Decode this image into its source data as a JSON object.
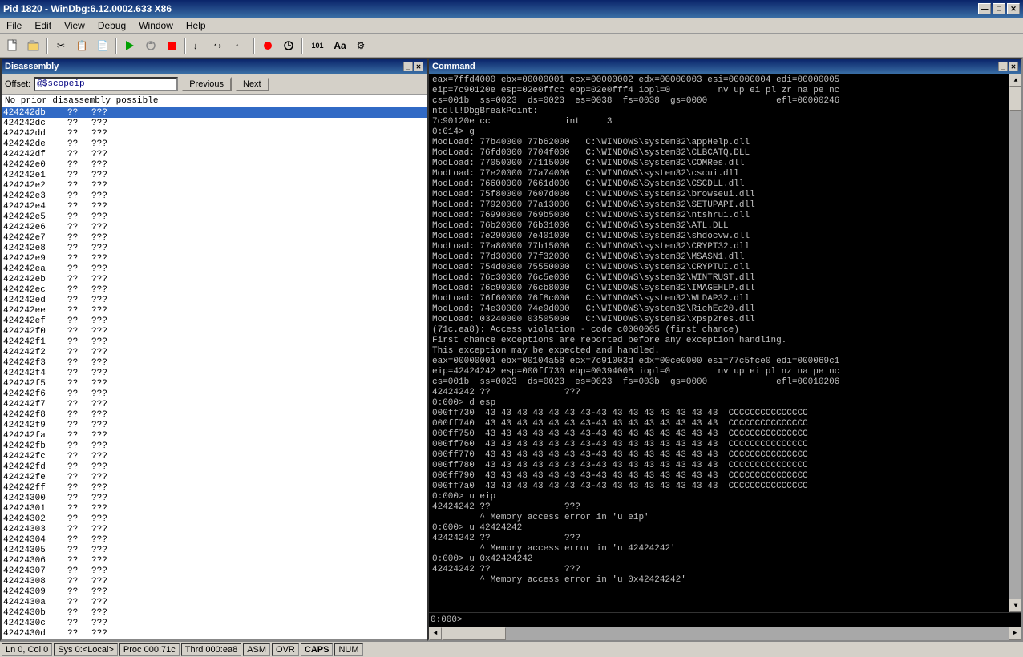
{
  "title_bar": {
    "title": "Pid 1820 - WinDbg:6.12.0002.633 X86",
    "min_btn": "—",
    "max_btn": "□",
    "close_btn": "✕"
  },
  "menu": {
    "items": [
      "File",
      "Edit",
      "View",
      "Debug",
      "Window",
      "Help"
    ]
  },
  "toolbar": {
    "buttons": [
      "✂",
      "📋",
      "📄",
      "▶",
      "⏸",
      "⏹",
      "↩",
      "↪",
      "⬇",
      "⬆",
      "⬇",
      "⬆",
      "👆",
      "⬅",
      "➡",
      "🔍",
      "🔍",
      "🔍",
      "🔍",
      "🔍",
      "🔍",
      "🔍",
      "≡",
      "Aa",
      "⚙"
    ]
  },
  "disasm_panel": {
    "title": "Disassembly",
    "offset_label": "Offset:",
    "offset_value": "@$scopeip",
    "prev_btn": "Previous",
    "next_btn": "Next",
    "message": "No prior disassembly possible",
    "rows": [
      {
        "addr": "424242db",
        "bytes": "??",
        "instr": "???",
        "selected": true
      },
      {
        "addr": "424242dc",
        "bytes": "??",
        "instr": "???"
      },
      {
        "addr": "424242dd",
        "bytes": "??",
        "instr": "???"
      },
      {
        "addr": "424242de",
        "bytes": "??",
        "instr": "???"
      },
      {
        "addr": "424242df",
        "bytes": "??",
        "instr": "???"
      },
      {
        "addr": "424242e0",
        "bytes": "??",
        "instr": "???"
      },
      {
        "addr": "424242e1",
        "bytes": "??",
        "instr": "???"
      },
      {
        "addr": "424242e2",
        "bytes": "??",
        "instr": "???"
      },
      {
        "addr": "424242e3",
        "bytes": "??",
        "instr": "???"
      },
      {
        "addr": "424242e4",
        "bytes": "??",
        "instr": "???"
      },
      {
        "addr": "424242e5",
        "bytes": "??",
        "instr": "???"
      },
      {
        "addr": "424242e6",
        "bytes": "??",
        "instr": "???"
      },
      {
        "addr": "424242e7",
        "bytes": "??",
        "instr": "???"
      },
      {
        "addr": "424242e8",
        "bytes": "??",
        "instr": "???"
      },
      {
        "addr": "424242e9",
        "bytes": "??",
        "instr": "???"
      },
      {
        "addr": "424242ea",
        "bytes": "??",
        "instr": "???"
      },
      {
        "addr": "424242eb",
        "bytes": "??",
        "instr": "???"
      },
      {
        "addr": "424242ec",
        "bytes": "??",
        "instr": "???"
      },
      {
        "addr": "424242ed",
        "bytes": "??",
        "instr": "???"
      },
      {
        "addr": "424242ee",
        "bytes": "??",
        "instr": "???"
      },
      {
        "addr": "424242ef",
        "bytes": "??",
        "instr": "???"
      },
      {
        "addr": "424242f0",
        "bytes": "??",
        "instr": "???"
      },
      {
        "addr": "424242f1",
        "bytes": "??",
        "instr": "???"
      },
      {
        "addr": "424242f2",
        "bytes": "??",
        "instr": "???"
      },
      {
        "addr": "424242f3",
        "bytes": "??",
        "instr": "???"
      },
      {
        "addr": "424242f4",
        "bytes": "??",
        "instr": "???"
      },
      {
        "addr": "424242f5",
        "bytes": "??",
        "instr": "???"
      },
      {
        "addr": "424242f6",
        "bytes": "??",
        "instr": "???"
      },
      {
        "addr": "424242f7",
        "bytes": "??",
        "instr": "???"
      },
      {
        "addr": "424242f8",
        "bytes": "??",
        "instr": "???"
      },
      {
        "addr": "424242f9",
        "bytes": "??",
        "instr": "???"
      },
      {
        "addr": "424242fa",
        "bytes": "??",
        "instr": "???"
      },
      {
        "addr": "424242fb",
        "bytes": "??",
        "instr": "???"
      },
      {
        "addr": "424242fc",
        "bytes": "??",
        "instr": "???"
      },
      {
        "addr": "424242fd",
        "bytes": "??",
        "instr": "???"
      },
      {
        "addr": "424242fe",
        "bytes": "??",
        "instr": "???"
      },
      {
        "addr": "424242ff",
        "bytes": "??",
        "instr": "???"
      },
      {
        "addr": "42424300",
        "bytes": "??",
        "instr": "???"
      },
      {
        "addr": "42424301",
        "bytes": "??",
        "instr": "???"
      },
      {
        "addr": "42424302",
        "bytes": "??",
        "instr": "???"
      },
      {
        "addr": "42424303",
        "bytes": "??",
        "instr": "???"
      },
      {
        "addr": "42424304",
        "bytes": "??",
        "instr": "???"
      },
      {
        "addr": "42424305",
        "bytes": "??",
        "instr": "???"
      },
      {
        "addr": "42424306",
        "bytes": "??",
        "instr": "???"
      },
      {
        "addr": "42424307",
        "bytes": "??",
        "instr": "???"
      },
      {
        "addr": "42424308",
        "bytes": "??",
        "instr": "???"
      },
      {
        "addr": "42424309",
        "bytes": "??",
        "instr": "???"
      },
      {
        "addr": "4242430a",
        "bytes": "??",
        "instr": "???"
      },
      {
        "addr": "4242430b",
        "bytes": "??",
        "instr": "???"
      },
      {
        "addr": "4242430c",
        "bytes": "??",
        "instr": "???"
      },
      {
        "addr": "4242430d",
        "bytes": "??",
        "instr": "???"
      }
    ]
  },
  "cmd_panel": {
    "title": "Command",
    "content": [
      "eax=7ffd4000 ebx=00000001 ecx=00000002 edx=00000003 esi=00000004 edi=00000005",
      "eip=7c90120e esp=02e0ffcc ebp=02e0fff4 iopl=0         nv up ei pl zr na pe nc",
      "cs=001b  ss=0023  ds=0023  es=0038  fs=0038  gs=0000             efl=00000246",
      "ntdll!DbgBreakPoint:",
      "7c90120e cc              int     3",
      "0:014> g",
      "ModLoad: 77b40000 77b62000   C:\\WINDOWS\\system32\\appHelp.dll",
      "ModLoad: 76fd0000 7704f000   C:\\WINDOWS\\system32\\CLBCATQ.DLL",
      "ModLoad: 77050000 77115000   C:\\WINDOWS\\system32\\COMRes.dll",
      "ModLoad: 77e20000 77a74000   C:\\WINDOWS\\system32\\cscui.dll",
      "ModLoad: 76600000 7661d000   C:\\WINDOWS\\System32\\CSCDLL.dll",
      "ModLoad: 75f80000 7607d000   C:\\WINDOWS\\system32\\browseui.dll",
      "ModLoad: 77920000 77a13000   C:\\WINDOWS\\system32\\SETUPAPI.dll",
      "ModLoad: 76990000 769b5000   C:\\WINDOWS\\system32\\ntshrui.dll",
      "ModLoad: 76b20000 76b31000   C:\\WINDOWS\\system32\\ATL.DLL",
      "ModLoad: 7e290000 7e401000   C:\\WINDOWS\\system32\\shdocvw.dll",
      "ModLoad: 77a80000 77b15000   C:\\WINDOWS\\system32\\CRYPT32.dll",
      "ModLoad: 77d30000 77f32000   C:\\WINDOWS\\system32\\MSASN1.dll",
      "ModLoad: 754d0000 75550000   C:\\WINDOWS\\system32\\CRYPTUI.dll",
      "ModLoad: 76c30000 76c5e000   C:\\WINDOWS\\system32\\WINTRUST.dll",
      "ModLoad: 76c90000 76cb8000   C:\\WINDOWS\\system32\\IMAGEHLP.dll",
      "ModLoad: 76f60000 76f8c000   C:\\WINDOWS\\system32\\WLDAP32.dll",
      "ModLoad: 74e30000 74e9d000   C:\\WINDOWS\\system32\\RichEd20.dll",
      "ModLoad: 03240000 03505000   C:\\WINDOWS\\system32\\xpsp2res.dll",
      "(71c.ea8): Access violation - code c0000005 (first chance)",
      "First chance exceptions are reported before any exception handling.",
      "This exception may be expected and handled.",
      "eax=00000001 ebx=00104a58 ecx=7c91003d edx=00ce0000 esi=77c5fce0 edi=000069c1",
      "eip=42424242 esp=000ff730 ebp=00394008 iopl=0         nv up ei pl nz na pe nc",
      "cs=001b  ss=0023  ds=0023  es=0023  fs=003b  gs=0000             efl=00010206",
      "42424242 ??              ???",
      "0:000> d esp",
      "000ff730  43 43 43 43 43 43 43-43 43 43 43 43 43 43 43  CCCCCCCCCCCCCCC",
      "000ff740  43 43 43 43 43 43 43-43 43 43 43 43 43 43 43  CCCCCCCCCCCCCCC",
      "000ff750  43 43 43 43 43 43 43-43 43 43 43 43 43 43 43  CCCCCCCCCCCCCCC",
      "000ff760  43 43 43 43 43 43 43-43 43 43 43 43 43 43 43  CCCCCCCCCCCCCCC",
      "000ff770  43 43 43 43 43 43 43-43 43 43 43 43 43 43 43  CCCCCCCCCCCCCCC",
      "000ff780  43 43 43 43 43 43 43-43 43 43 43 43 43 43 43  CCCCCCCCCCCCCCC",
      "000ff790  43 43 43 43 43 43 43-43 43 43 43 43 43 43 43  CCCCCCCCCCCCCCC",
      "000ff7a0  43 43 43 43 43 43 43-43 43 43 43 43 43 43 43  CCCCCCCCCCCCCCC",
      "0:000> u eip",
      "42424242 ??              ???",
      "         ^ Memory access error in 'u eip'",
      "0:000> u 42424242",
      "42424242 ??              ???",
      "         ^ Memory access error in 'u 42424242'",
      "0:000> u 0x42424242",
      "42424242 ??              ???",
      "         ^ Memory access error in 'u 0x42424242'"
    ],
    "prompt": "0:000> ",
    "input_value": ""
  },
  "status_bar": {
    "items": [
      {
        "label": "Ln 0, Col 0"
      },
      {
        "label": "Sys 0:<Local>"
      },
      {
        "label": "Proc 000:71c"
      },
      {
        "label": "Thrd 000:ea8"
      },
      {
        "label": "ASM"
      },
      {
        "label": "OVR"
      },
      {
        "label": "CAPS",
        "active": true
      },
      {
        "label": "NUM"
      }
    ]
  }
}
